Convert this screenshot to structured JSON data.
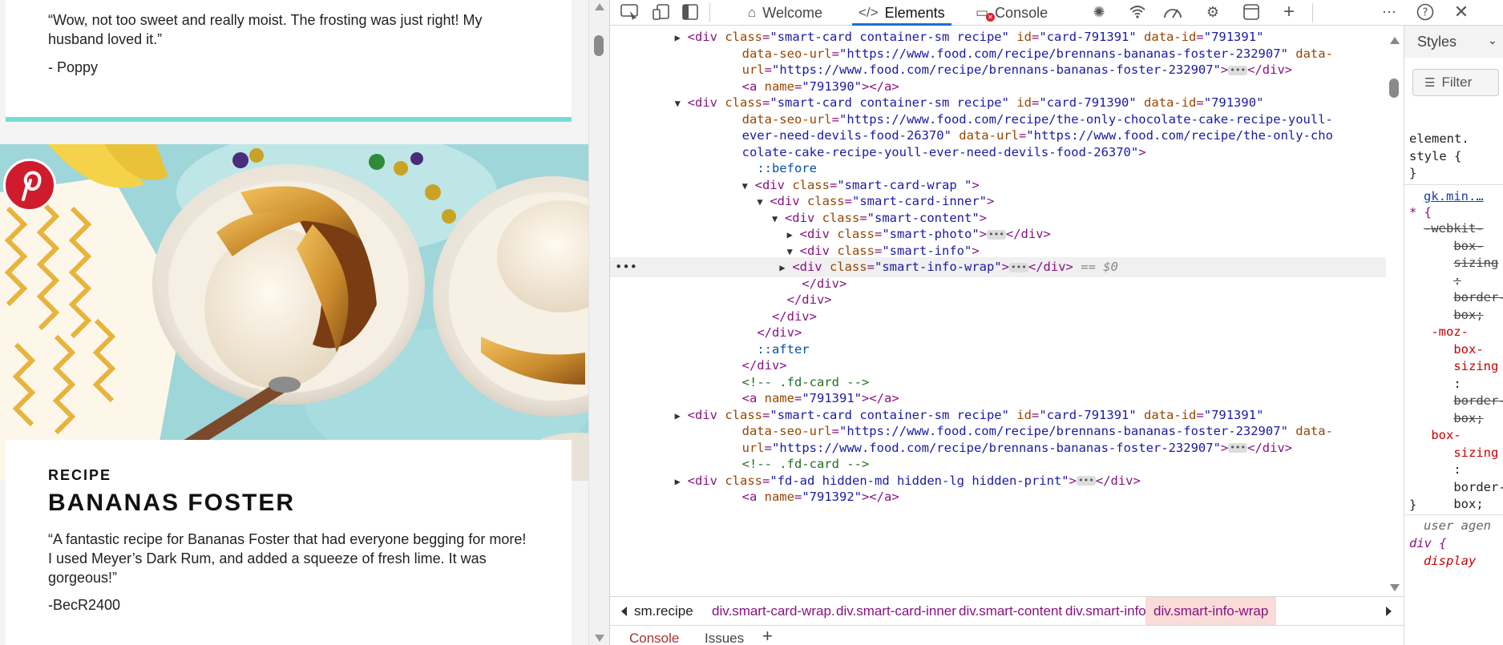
{
  "page": {
    "review1": {
      "quote": "“Wow, not too sweet and really moist. The frosting was just right! My husband loved it.”",
      "author": "- Poppy"
    },
    "photo_alt": "bananas-foster-photo",
    "recipe": {
      "kicker": "RECIPE",
      "title": "BANANAS FOSTER",
      "quote": "“A fantastic recipe for Bananas Foster that had everyone begging for more! I used Meyer’s Dark Rum, and added a squeeze of fresh lime. It was gorgeous!”",
      "author": "-BecR2400"
    },
    "colors": {
      "accent": "#74dcd8",
      "pinterest": "#cf1c2c"
    }
  },
  "devtools": {
    "tabs": {
      "welcome": "Welcome",
      "elements": "Elements",
      "console": "Console"
    },
    "icons": [
      "inspect-icon",
      "device-emulation-icon",
      "sidebar-toggle-icon",
      "home-icon",
      "code-icon",
      "console-icon",
      "bug-icon",
      "wifi-icon",
      "performance-icon",
      "gear-chip-icon",
      "application-icon",
      "add-icon",
      "more-icon",
      "help-icon",
      "close-icon"
    ],
    "dom": {
      "l1a": "<div",
      "l1": [
        [
          "class",
          "smart-card container-sm recipe"
        ],
        [
          "id",
          "card-791391"
        ],
        [
          "data-id",
          "791391"
        ]
      ],
      "l2": [
        [
          "data-seo-url",
          "https://www.food.com/recipe/brennans-bananas-foster-232907"
        ]
      ],
      "l2b": "data-",
      "l3a": "url",
      "l3v": "https://www.food.com/recipe/brennans-bananas-foster-232907",
      "anchor1": "791390",
      "card2": {
        "class": "smart-card container-sm recipe",
        "id": "card-791390",
        "data_id": "791390",
        "seo_url_a": "https://www.food.com/recipe/the-only-chocolate-cake-recipe-youll-",
        "seo_url_b": "ever-need-devils-food-26370",
        "data_url_a": "https://www.food.com/recipe/the-only-cho",
        "data_url_b": "colate-cake-recipe-youll-ever-need-devils-food-26370"
      },
      "before": "::before",
      "after": "::after",
      "wrap": "smart-card-wrap ",
      "inner": "smart-card-inner",
      "content": "smart-content",
      "photo": "smart-photo",
      "info": "smart-info",
      "info_wrap": "smart-info-wrap",
      "selected_marker": "== $0",
      "comment": "<!-- .fd-card -->",
      "anchor2": "791391",
      "card3": {
        "class": "smart-card container-sm recipe",
        "id": "card-791391",
        "data_id": "791391",
        "seo_url": "https://www.food.com/recipe/brennans-bananas-foster-232907",
        "data_url": "https://www.food.com/recipe/brennans-bananas-foster-232907"
      },
      "ad_class": "fd-ad hidden-md hidden-lg hidden-print",
      "anchor3": "791392"
    },
    "breadcrumbs": [
      "sm.recipe",
      "div.smart-card-wrap.",
      "div.smart-card-inner",
      "div.smart-content",
      "div.smart-info",
      "div.smart-info-wrap"
    ],
    "drawer": {
      "console": "Console",
      "issues": "Issues"
    },
    "styles": {
      "tab": "Styles",
      "filter": "Filter",
      "element_style_a": "element.",
      "element_style_b": "style {",
      "close_brace": "}",
      "source": "gk.min.…",
      "selector": "* {",
      "rules": [
        "-webkit-",
        "box-",
        "sizing",
        ":",
        "border-",
        "box;",
        "-moz-",
        "box-",
        "sizing",
        ":",
        "border-",
        "box;",
        "box-",
        "sizing",
        ":",
        "border-",
        "box;"
      ],
      "user_agent": "user agen",
      "ua_selector": "div {",
      "ua_prop": "display"
    }
  }
}
